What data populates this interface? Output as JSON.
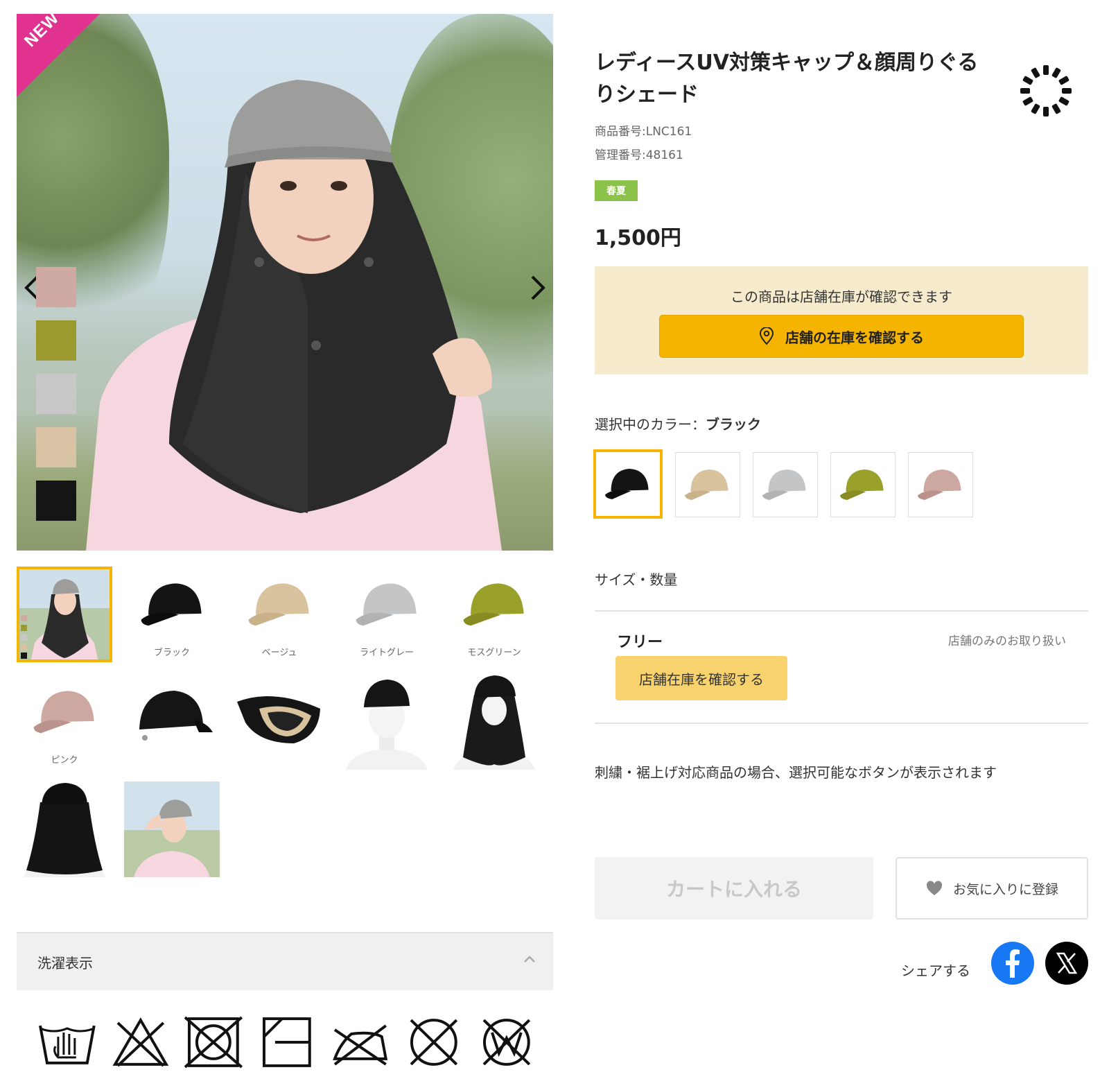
{
  "gallery": {
    "new_badge": "NEW",
    "prev_icon": "chevron-left-icon",
    "next_icon": "chevron-right-icon",
    "swatch_colors": [
      "#cfaaa4",
      "#9a9a2e",
      "#c8c8c8",
      "#d8c4a4",
      "#151515"
    ],
    "thumbnails": [
      {
        "label": ""
      },
      {
        "label": "ブラック"
      },
      {
        "label": "ベージュ"
      },
      {
        "label": "ライトグレー"
      },
      {
        "label": "モスグリーン"
      },
      {
        "label": "ピンク"
      },
      {
        "label": ""
      },
      {
        "label": ""
      },
      {
        "label": ""
      },
      {
        "label": ""
      },
      {
        "label": ""
      },
      {
        "label": ""
      }
    ]
  },
  "wash": {
    "title": "洗濯表示",
    "toggle_icon": "chevron-up-icon",
    "icons": [
      "hand-wash-icon",
      "no-bleach-icon",
      "no-tumble-dry-icon",
      "drip-dry-shade-icon",
      "no-iron-icon",
      "no-dry-clean-icon",
      "no-wet-clean-icon"
    ]
  },
  "product": {
    "title": "レディースUV対策キャップ＆顔周りぐるりシェード",
    "item_number": "商品番号:LNC161",
    "control_number": "管理番号:48161",
    "season_badge": "春夏",
    "price": "1,500円"
  },
  "stock": {
    "message": "この商品は店舗在庫が確認できます",
    "button_label": "店舗の在庫を確認する",
    "button_icon": "map-pin-icon"
  },
  "color": {
    "label_prefix": "選択中のカラー：",
    "selected": "ブラック",
    "options": [
      {
        "name": "black",
        "color": "#141414"
      },
      {
        "name": "beige",
        "color": "#d9c39e"
      },
      {
        "name": "light-gray",
        "color": "#c4c5c7"
      },
      {
        "name": "moss-green",
        "color": "#9aa12a"
      },
      {
        "name": "pink",
        "color": "#cda8a1"
      }
    ]
  },
  "size": {
    "label": "サイズ・数量",
    "name": "フリー",
    "store_only": "店舗のみのお取り扱い",
    "store_stock_button": "店舗在庫を確認する"
  },
  "embroidery_note": "刺繍・裾上げ対応商品の場合、選択可能なボタンが表示されます",
  "actions": {
    "cart_label": "カートに入れる",
    "favorite_label": "お気に入りに登録",
    "favorite_icon": "heart-icon"
  },
  "share": {
    "label": "シェアする",
    "icons": [
      "facebook-icon",
      "x-icon"
    ]
  },
  "colors": {
    "accent": "#f5b400",
    "badge_pink": "#e0328e",
    "season_green": "#8bc34a",
    "stock_bg": "#f6eccd"
  }
}
